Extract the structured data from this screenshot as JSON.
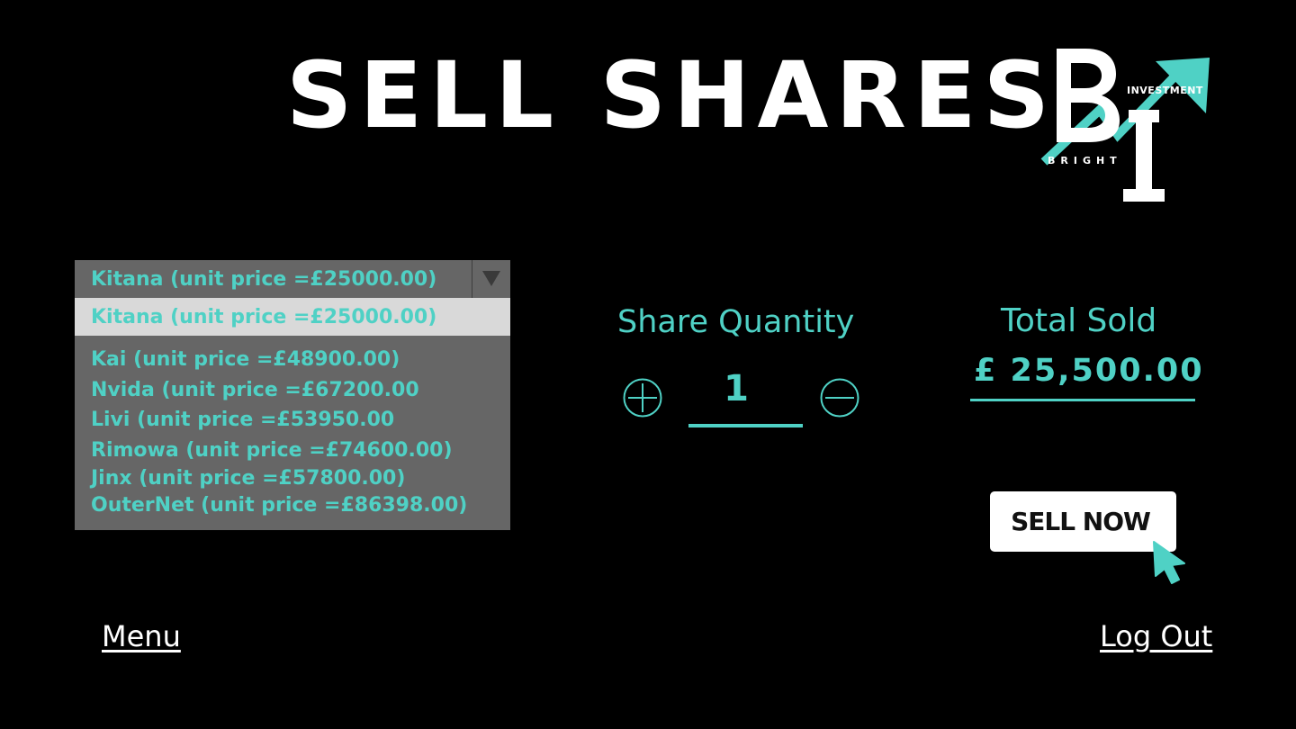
{
  "header": {
    "title": "SELL SHARES"
  },
  "logo": {
    "word_top": "INVESTMENT",
    "word_bottom": "BRIGHT",
    "brand_mark": "BI"
  },
  "colors": {
    "background": "#000000",
    "accent": "#4fd1c5",
    "dropdown_bg": "#666666",
    "dropdown_highlight": "#d9d9d9",
    "text_light": "#ffffff"
  },
  "share_select": {
    "selected": "Kitana (unit price =£25000.00)",
    "highlighted": "Kitana (unit price =£25000.00)",
    "options": [
      "Kai (unit price =£48900.00)",
      "Nvida (unit price =£67200.00",
      "Livi (unit price =£53950.00",
      "Rimowa (unit price =£74600.00)",
      "Jinx (unit price =£57800.00)",
      "OuterNet (unit price =£86398.00)"
    ],
    "arrow_icon": "triangle-down-icon"
  },
  "quantity": {
    "label": "Share Quantity",
    "value": "1",
    "increase_icon": "plus-circle-icon",
    "decrease_icon": "minus-circle-icon"
  },
  "total": {
    "label": "Total Sold",
    "value": "£ 25,500.00"
  },
  "actions": {
    "sell_label": "SELL NOW",
    "cursor_icon": "pointer-cursor-icon"
  },
  "footer": {
    "menu_label": "Menu",
    "logout_label": "Log Out"
  }
}
